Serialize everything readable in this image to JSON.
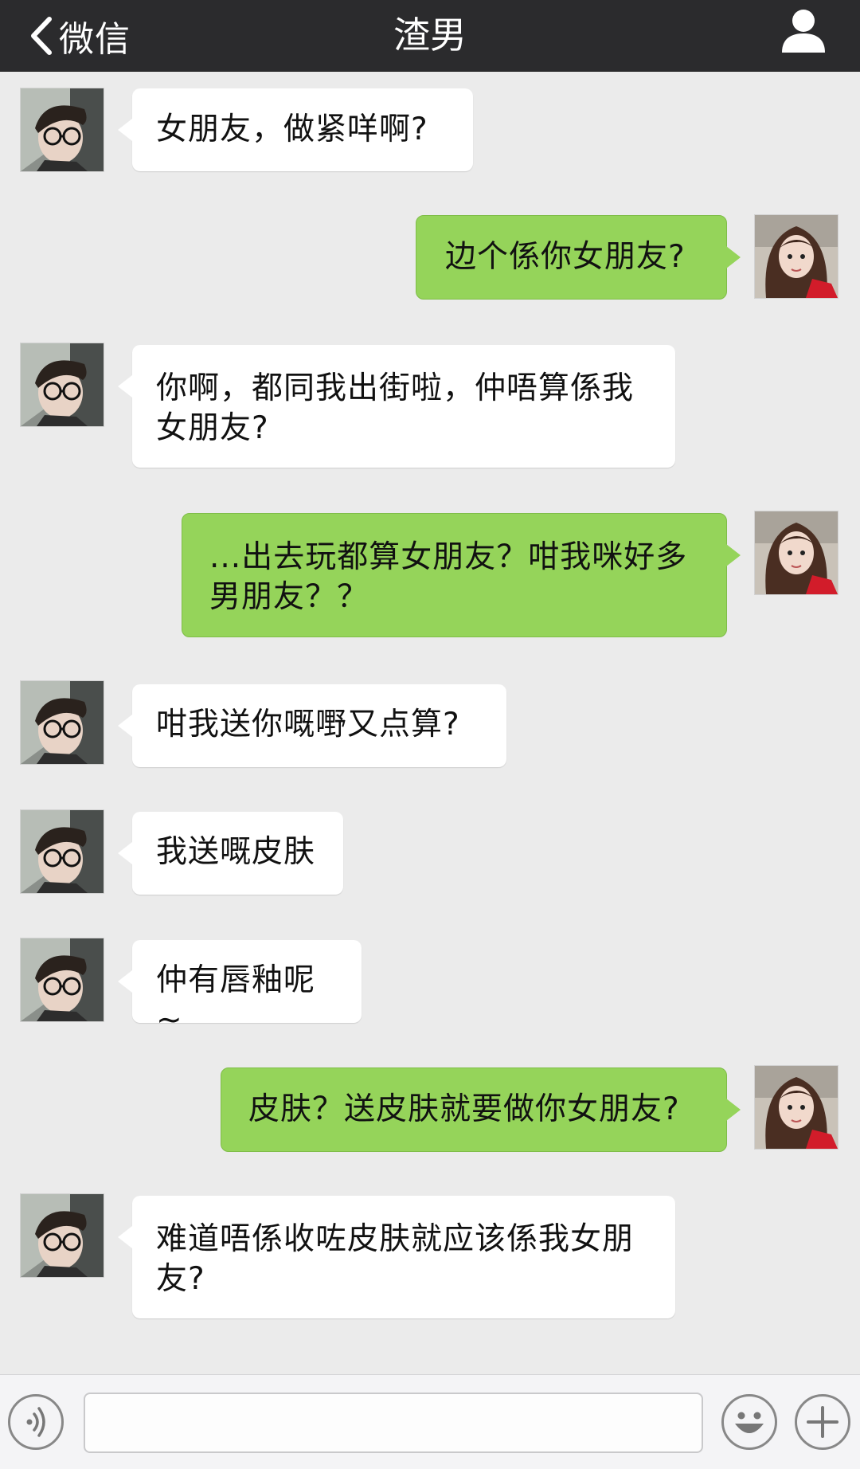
{
  "nav": {
    "back_label": "微信",
    "title": "渣男"
  },
  "messages": [
    {
      "from": "other",
      "text": "女朋友，做紧咩啊?"
    },
    {
      "from": "me",
      "text": "边个係你女朋友?"
    },
    {
      "from": "other",
      "text": "你啊，都同我出街啦，仲唔算係我女朋友?"
    },
    {
      "from": "me",
      "text": "...出去玩都算女朋友？咁我咪好多男朋友？？"
    },
    {
      "from": "other",
      "text": "咁我送你嘅嘢又点算?"
    },
    {
      "from": "other",
      "text": "我送嘅皮肤"
    },
    {
      "from": "other",
      "text": "仲有唇釉呢~"
    },
    {
      "from": "me",
      "text": "皮肤？送皮肤就要做你女朋友?"
    },
    {
      "from": "other",
      "text": "难道唔係收咗皮肤就应该係我女朋友?"
    }
  ],
  "input": {
    "value": "",
    "placeholder": ""
  },
  "icons": {
    "back": "chevron-left-icon",
    "profile": "person-icon",
    "voice": "voice-icon",
    "emoji": "smiley-icon",
    "more": "plus-icon"
  },
  "colors": {
    "navbar": "#2b2b2d",
    "background": "#ebebeb",
    "my_bubble": "#95d45a",
    "their_bubble": "#ffffff"
  }
}
